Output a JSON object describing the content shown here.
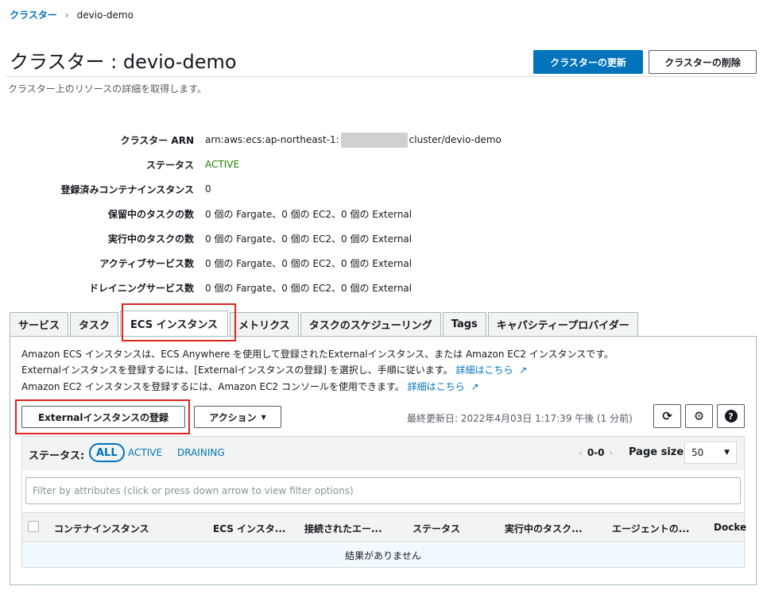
{
  "breadcrumb": {
    "root": "クラスター",
    "separator": "›",
    "current": "devio-demo"
  },
  "header": {
    "title": "クラスター : devio-demo",
    "subtitle": "クラスター上のリソースの詳細を取得します。",
    "update_button": "クラスターの更新",
    "delete_button": "クラスターの削除"
  },
  "details": {
    "arn_label": "クラスター ARN",
    "arn_prefix": "arn:aws:ecs:ap-northeast-1:",
    "arn_suffix": "cluster/devio-demo",
    "status_label": "ステータス",
    "status_value": "ACTIVE",
    "registered_label": "登録済みコンテナインスタンス",
    "registered_value": "0",
    "pending_label": "保留中のタスクの数",
    "pending_value": "0 個の Fargate、0 個の EC2、0 個の External",
    "running_label": "実行中のタスクの数",
    "running_value": "0 個の Fargate、0 個の EC2、0 個の External",
    "active_services_label": "アクティブサービス数",
    "active_services_value": "0 個の Fargate、0 個の EC2、0 個の External",
    "draining_services_label": "ドレイニングサービス数",
    "draining_services_value": "0 個の Fargate、0 個の EC2、0 個の External"
  },
  "tabs": {
    "services": "サービス",
    "tasks": "タスク",
    "ecs_instances": "ECS インスタンス",
    "metrics": "メトリクス",
    "scheduled_tasks": "タスクのスケジューリング",
    "tags": "Tags",
    "capacity_providers": "キャパシティープロバイダー",
    "active": "ecs_instances"
  },
  "panel": {
    "desc1": "Amazon ECS インスタンスは、ECS Anywhere を使用して登録されたExternalインスタンス、または Amazon EC2 インスタンスです。",
    "desc2": "Externalインスタンスを登録するには、[Externalインスタンスの登録] を選択し、手順に従います。",
    "desc2_link": "詳細はこちら",
    "desc3": "Amazon EC2 インスタンスを登録するには、Amazon EC2 コンソールを使用できます。",
    "desc3_link": "詳細はこちら",
    "register_button": "Externalインスタンスの登録",
    "action_button": "アクション",
    "last_updated": "最終更新日: 2022年4月03日 1:17:39 午後 (1 分前)",
    "refresh_icon": "refresh-icon",
    "settings_icon": "gear-icon",
    "info_icon": "info-icon"
  },
  "filter": {
    "status_label": "ステータス:",
    "all": "ALL",
    "active": "ACTIVE",
    "draining": "DRAINING",
    "range": "0-0",
    "page_size_label": "Page size",
    "page_size": "50",
    "placeholder": "Filter by attributes (click or press down arrow to view filter options)"
  },
  "table": {
    "columns": [
      "コンテナインスタンス",
      "ECS インスタ...",
      "接続されたエー...",
      "ステータス",
      "実行中のタスク...",
      "エージェントの...",
      "Docke"
    ],
    "empty": "結果がありません"
  },
  "colors": {
    "accent": "#0073bb",
    "active_status": "#1d8102",
    "highlight": "#e0241b"
  }
}
